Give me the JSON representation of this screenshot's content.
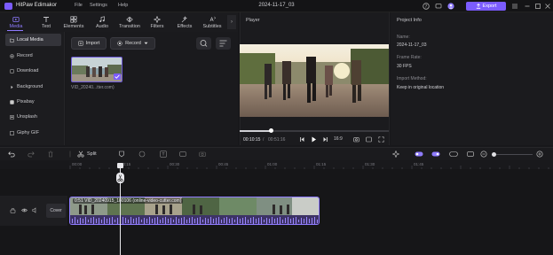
{
  "titlebar": {
    "app_name": "HitPaw Edimakor",
    "menus": [
      "File",
      "Settings",
      "Help"
    ],
    "document_title": "2024-11-17_03",
    "export_label": "Export"
  },
  "toolbar": {
    "tools": [
      {
        "label": "Media",
        "icon": "media-icon",
        "active": true
      },
      {
        "label": "Text",
        "icon": "text-icon",
        "active": false
      },
      {
        "label": "Elements",
        "icon": "elements-icon",
        "active": false
      },
      {
        "label": "Audio",
        "icon": "audio-icon",
        "active": false
      },
      {
        "label": "Transition",
        "icon": "transition-icon",
        "active": false
      },
      {
        "label": "Filters",
        "icon": "filters-icon",
        "active": false
      },
      {
        "label": "Effects",
        "icon": "effects-icon",
        "active": false
      },
      {
        "label": "Subtitles",
        "icon": "subtitles-icon",
        "active": false
      }
    ]
  },
  "sidebar": {
    "items": [
      {
        "label": "Local Media",
        "active": true
      },
      {
        "label": "Record",
        "active": false
      },
      {
        "label": "Download",
        "active": false
      },
      {
        "label": "Background",
        "active": false
      },
      {
        "label": "Pixabay",
        "active": false
      },
      {
        "label": "Unsplash",
        "active": false
      },
      {
        "label": "Giphy GIF",
        "active": false
      }
    ]
  },
  "media": {
    "import_label": "Import",
    "record_label": "Record",
    "clip_name": "VID_20240...tter.com)"
  },
  "player": {
    "label": "Player",
    "current_time": "00:10:15",
    "separator": "/",
    "total_time": "00:51:16",
    "ratio": "16:9",
    "progress_fraction": 0.2
  },
  "project_info": {
    "title": "Project Info",
    "fields": [
      {
        "label": "Name:",
        "value": "2024-11-17_03"
      },
      {
        "label": "Frame Rate:",
        "value": "30 FPS"
      },
      {
        "label": "Import Method:",
        "value": "Keep in original location"
      }
    ]
  },
  "timeline": {
    "split_label": "Split",
    "ruler_ticks": [
      "00:00",
      "00:15",
      "00:30",
      "00:45",
      "01:00",
      "01:15",
      "01:30",
      "01:45"
    ],
    "cover_label": "Cover",
    "clip_label": "0:51  VID_20240915_180106 (online-video-cutter.com)"
  },
  "colors": {
    "accent": "#7b5cff",
    "background": "#18181b",
    "panel": "#1b1b1e"
  }
}
